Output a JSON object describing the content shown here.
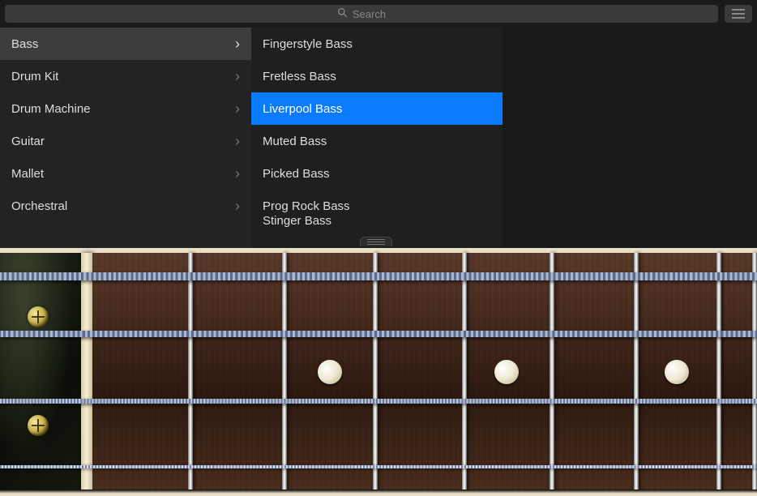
{
  "search": {
    "placeholder": "Search"
  },
  "categories": {
    "items": [
      {
        "label": "Bass"
      },
      {
        "label": "Drum Kit"
      },
      {
        "label": "Drum Machine"
      },
      {
        "label": "Guitar"
      },
      {
        "label": "Mallet"
      },
      {
        "label": "Orchestral"
      }
    ],
    "selected_index": 0
  },
  "presets": {
    "items": [
      {
        "label": "Fingerstyle Bass"
      },
      {
        "label": "Fretless Bass"
      },
      {
        "label": "Liverpool Bass"
      },
      {
        "label": "Muted Bass"
      },
      {
        "label": "Picked Bass"
      },
      {
        "label": "Prog Rock Bass"
      },
      {
        "label": "Stinger Bass"
      }
    ],
    "selected_index": 2
  },
  "instrument": {
    "type": "bass",
    "strings": 4,
    "frets_visible": 7,
    "inlay_frets": [
      3,
      5,
      7
    ]
  }
}
